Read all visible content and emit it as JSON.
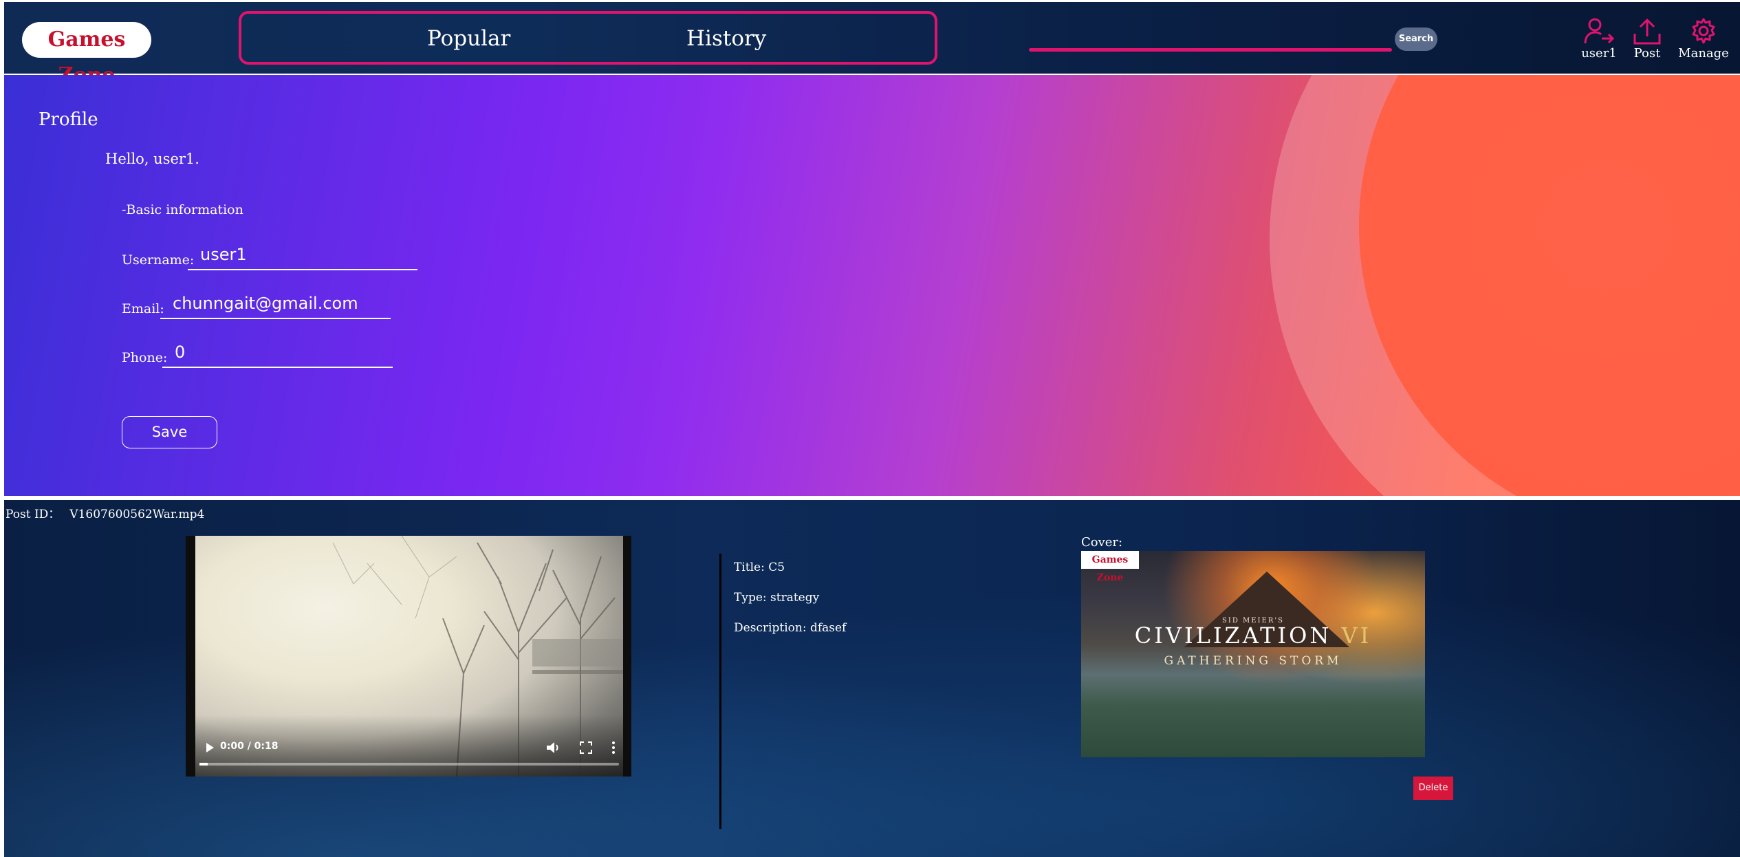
{
  "header": {
    "logo": "Games Zone",
    "nav": {
      "popular": "Popular",
      "history": "History"
    },
    "search": {
      "value": "",
      "placeholder": "",
      "button_label": "Search"
    },
    "actions": {
      "user": "user1",
      "post": "Post",
      "manage": "Manage"
    },
    "accent_color": "#e0146e"
  },
  "profile": {
    "title": "Profile",
    "greeting": "Hello, user1.",
    "section": "-Basic information",
    "username_label": "Username:",
    "username_value": "user1",
    "email_label": "Email:",
    "email_value": "chunngait@gmail.com",
    "phone_label": "Phone:",
    "phone_value": "0",
    "save_label": "Save"
  },
  "post": {
    "id_label": "Post ID：",
    "id_value": "V1607600562War.mp4",
    "video": {
      "time": "0:00 / 0:18",
      "progress": 0.0
    },
    "title": "Title: C5",
    "type": "Type: strategy",
    "description": "Description: dfasef",
    "cover_label": "Cover:",
    "cover": {
      "badge": "Games Zone",
      "kicker": "SID MEIER'S",
      "title": "CIVILIZATION",
      "title_numeral": "VI",
      "subtitle": "GATHERING STORM"
    },
    "delete_label": "Delete"
  }
}
